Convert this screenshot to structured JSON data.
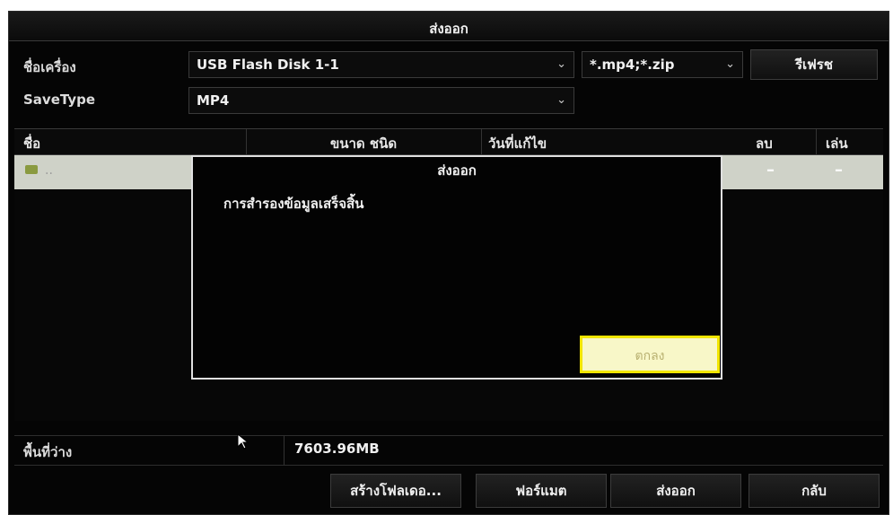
{
  "window": {
    "title": "ส่งออก"
  },
  "device": {
    "label": "ชื่อเครื่อง",
    "value": "USB Flash Disk 1-1",
    "filter": "*.mp4;*.zip",
    "refresh_label": "รีเฟรช"
  },
  "save_type": {
    "label": "SaveType",
    "value": "MP4"
  },
  "table": {
    "columns": [
      "ชื่อ",
      "ขนาด ชนิด",
      "วันที่แก้ไข",
      "ลบ",
      "เล่น"
    ],
    "rows": [
      {
        "name": "..",
        "delete": "–",
        "play": "–"
      }
    ]
  },
  "dialog": {
    "title": "ส่งออก",
    "message": "การสำรองข้อมูลเสร็จสิ้น",
    "ok_label": "ตกลง"
  },
  "free_space": {
    "label": "พื้นที่ว่าง",
    "value": "7603.96MB"
  },
  "footer": {
    "new_folder": "สร้างโฟลเดอ...",
    "format": "ฟอร์แมต",
    "export": "ส่งออก",
    "back": "กลับ"
  },
  "colors": {
    "highlight": "#f2e600",
    "selected_row": "#cfd2c8"
  }
}
